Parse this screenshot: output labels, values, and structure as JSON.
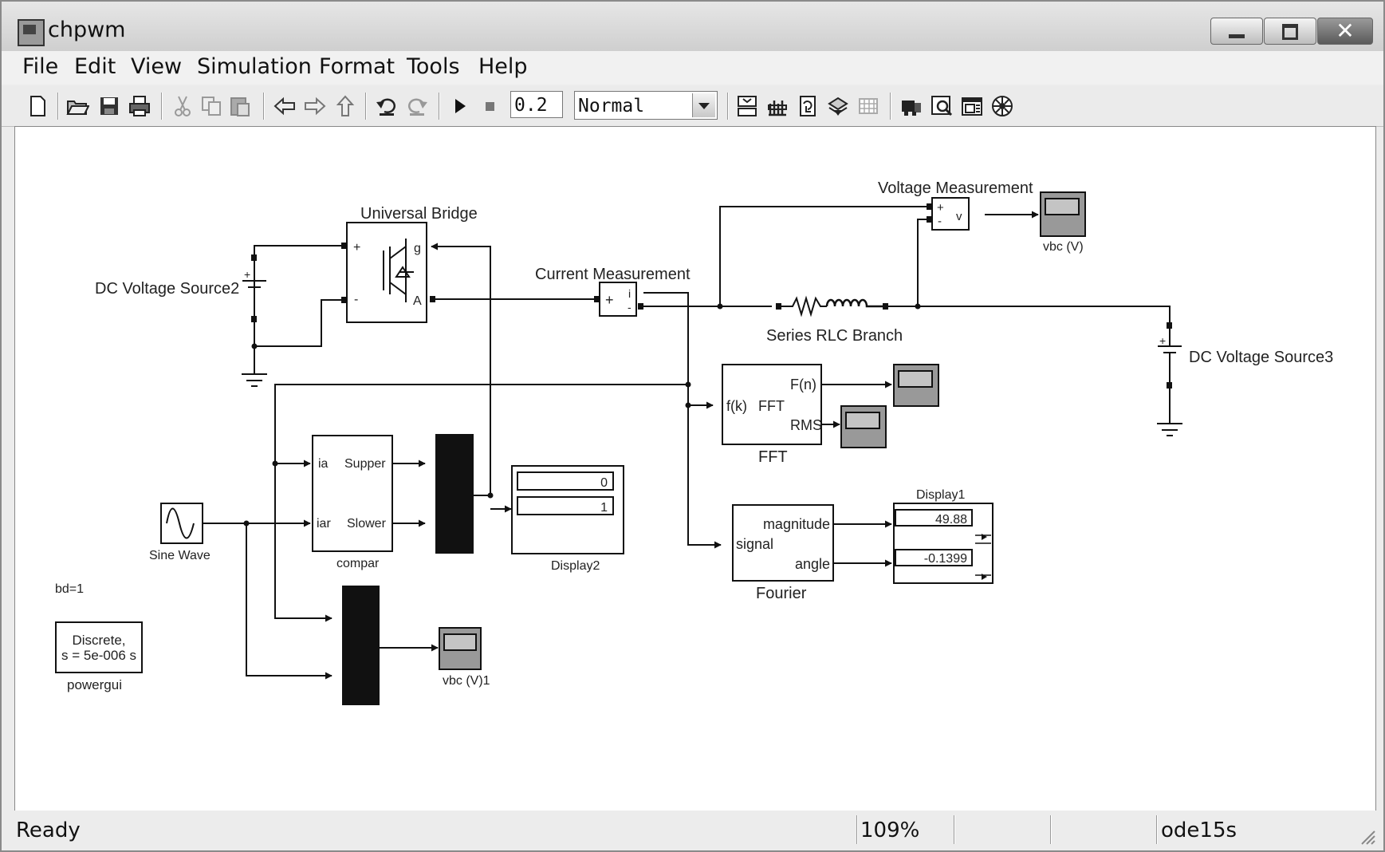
{
  "window": {
    "title": "chpwm"
  },
  "menu": [
    "File",
    "Edit",
    "View",
    "Simulation",
    "Format",
    "Tools",
    "Help"
  ],
  "toolbar": {
    "stop_time": "0.2",
    "sim_mode": "Normal",
    "icons": [
      "new-icon",
      "open-icon",
      "save-icon",
      "print-icon",
      "cut-icon",
      "copy-icon",
      "paste-icon",
      "back-icon",
      "forward-icon",
      "up-icon",
      "undo-icon",
      "redo-icon",
      "start-icon",
      "stop-icon",
      "build-icon",
      "update-icon",
      "library-icon",
      "explorer-icon",
      "debug-icon",
      "model-browser-icon",
      "zoom-icon",
      "properties-icon",
      "advisor-icon"
    ]
  },
  "blocks": {
    "universal_bridge": {
      "name": "Universal Bridge",
      "port_plus": "+",
      "port_minus": "-",
      "port_g": "g",
      "port_a": "A"
    },
    "dc_source2": {
      "name": "DC Voltage Source2"
    },
    "dc_source3": {
      "name": "DC Voltage Source3"
    },
    "current_measurement": {
      "name": "Current Measurement",
      "port_plus": "+",
      "port_i": "i",
      "port_minus": "-"
    },
    "voltage_measurement": {
      "name": "Voltage Measurement",
      "port_plus": "+",
      "port_minus": "-",
      "port_v": "v"
    },
    "series_rlc": {
      "name": "Series RLC Branch"
    },
    "scope_vbc": {
      "name": "vbc (V)"
    },
    "scope_vbc1": {
      "name": "vbc (V)1"
    },
    "fft": {
      "name": "FFT",
      "in": "f(k)",
      "center": "FFT",
      "out1": "F(n)",
      "out2": "RMS"
    },
    "compar": {
      "name": "compar",
      "in1": "ia",
      "in2": "iar",
      "out1": "Supper",
      "out2": "Slower"
    },
    "sine_wave": {
      "name": "Sine Wave"
    },
    "display2": {
      "name": "Display2",
      "value1": "0",
      "value2": "1"
    },
    "display1": {
      "name": "Display1",
      "value1": "49.88",
      "value2": "-0.1399"
    },
    "fourier": {
      "name": "Fourier",
      "in": "signal",
      "out1": "magnitude",
      "out2": "angle"
    },
    "powergui": {
      "name": "powergui",
      "line1": "Discrete,",
      "line2": "s = 5e-006 s"
    },
    "annotation": {
      "text": "bd=1"
    }
  },
  "status": {
    "state": "Ready",
    "zoom": "109%",
    "solver": "ode15s"
  }
}
